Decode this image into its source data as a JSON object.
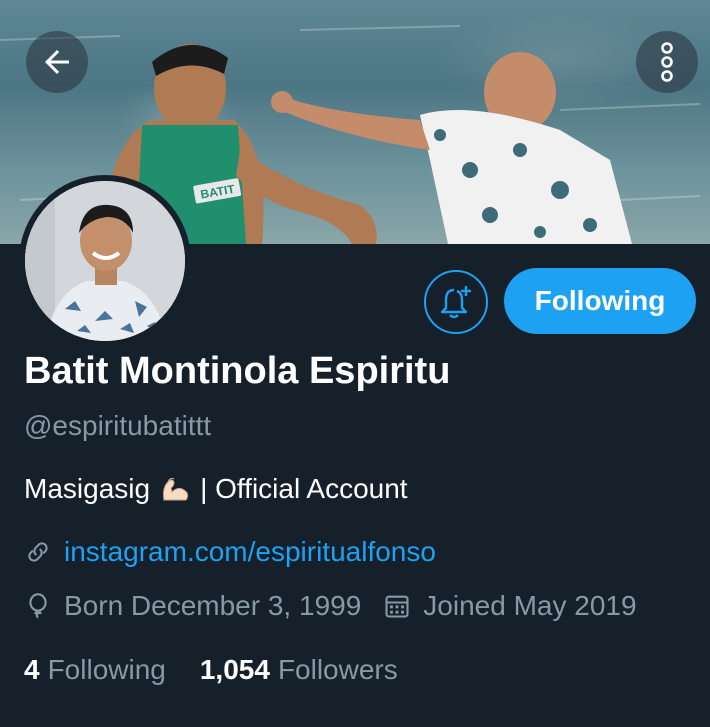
{
  "profile": {
    "name": "Batit Montinola Espiritu",
    "handle": "@espiritubatittt",
    "bio_text": "Masigasig",
    "bio_emoji": "flexed-biceps-emoji",
    "bio_suffix": "| Official Account",
    "website": "instagram.com/espiritualfonso",
    "born": "Born December 3, 1999",
    "joined": "Joined May 2019",
    "following_count": "4",
    "following_label": "Following",
    "followers_count": "1,054",
    "followers_label": "Followers"
  },
  "actions": {
    "follow_button_label": "Following",
    "back_icon": "arrow-left-icon",
    "more_icon": "more-vertical-icon",
    "notify_icon": "bell-plus-icon"
  },
  "banner": {
    "jersey_text": "BATIT"
  },
  "colors": {
    "background": "#15202b",
    "accent": "#1da1f2",
    "secondary_text": "#8899a6",
    "primary_text": "#ffffff"
  }
}
